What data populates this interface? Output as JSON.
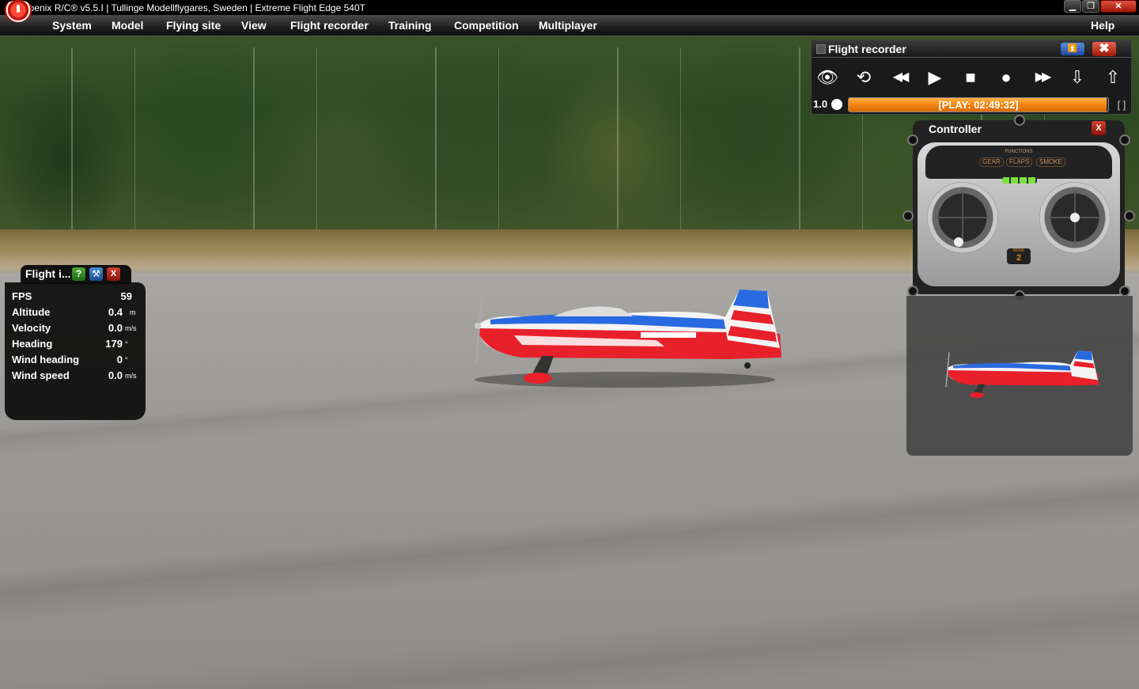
{
  "window": {
    "title": "Phoenix R/C® v5.5.I  |  Tullinge Modellflygares, Sweden  |  Extreme Flight Edge 540T",
    "minimize_glyph": "▁",
    "maximize_glyph": "❐",
    "close_glyph": "✕"
  },
  "menu": {
    "items": [
      {
        "label": "System"
      },
      {
        "label": "Model"
      },
      {
        "label": "Flying site"
      },
      {
        "label": "View"
      },
      {
        "label": "Flight recorder"
      },
      {
        "label": "Training"
      },
      {
        "label": "Competition"
      },
      {
        "label": "Multiplayer"
      },
      {
        "label": "Help"
      }
    ]
  },
  "flight_info": {
    "title": "Flight i...",
    "help_glyph": "?",
    "tools_glyph": "⚒",
    "close_glyph": "X",
    "rows": [
      {
        "label": "FPS",
        "value": "59",
        "unit": ""
      },
      {
        "label": "Altitude",
        "value": "0.4",
        "unit": "m"
      },
      {
        "label": "Velocity",
        "value": "0.0",
        "unit": "m/s"
      },
      {
        "label": "Heading",
        "value": "179",
        "unit": "°"
      },
      {
        "label": "Wind heading",
        "value": "0",
        "unit": "°"
      },
      {
        "label": "Wind speed",
        "value": "0.0",
        "unit": "m/s"
      }
    ]
  },
  "flight_recorder": {
    "title": "Flight recorder",
    "collapse_glyph": "⏫",
    "close_glyph": "✖",
    "buttons": [
      {
        "name": "view",
        "glyph": "👁"
      },
      {
        "name": "loop",
        "glyph": "⟲"
      },
      {
        "name": "rewind",
        "glyph": "◀◀"
      },
      {
        "name": "play",
        "glyph": "▶"
      },
      {
        "name": "stop",
        "glyph": "■"
      },
      {
        "name": "record",
        "glyph": "●"
      },
      {
        "name": "fast-forward",
        "glyph": "▶▶"
      },
      {
        "name": "download",
        "glyph": "⇩"
      },
      {
        "name": "upload",
        "glyph": "⇧"
      }
    ],
    "speed": "1.0",
    "status": "[PLAY: 02:49:32]",
    "progress": 0.995,
    "bracket_glyph": "[ ]"
  },
  "controller": {
    "title": "Controller",
    "close_glyph": "X",
    "functions_label": "FUNCTIONS",
    "switches": [
      "GEAR",
      "FLAPS",
      "SMOKE"
    ],
    "mode_label": "MODE",
    "mode_value": "2"
  },
  "scene": {
    "aircraft_livery": "Extreme Flight",
    "accent_colors": {
      "red": "#e8202a",
      "blue": "#2a6ae0",
      "white": "#f4f4f4",
      "progress_orange": "#f08010"
    }
  }
}
